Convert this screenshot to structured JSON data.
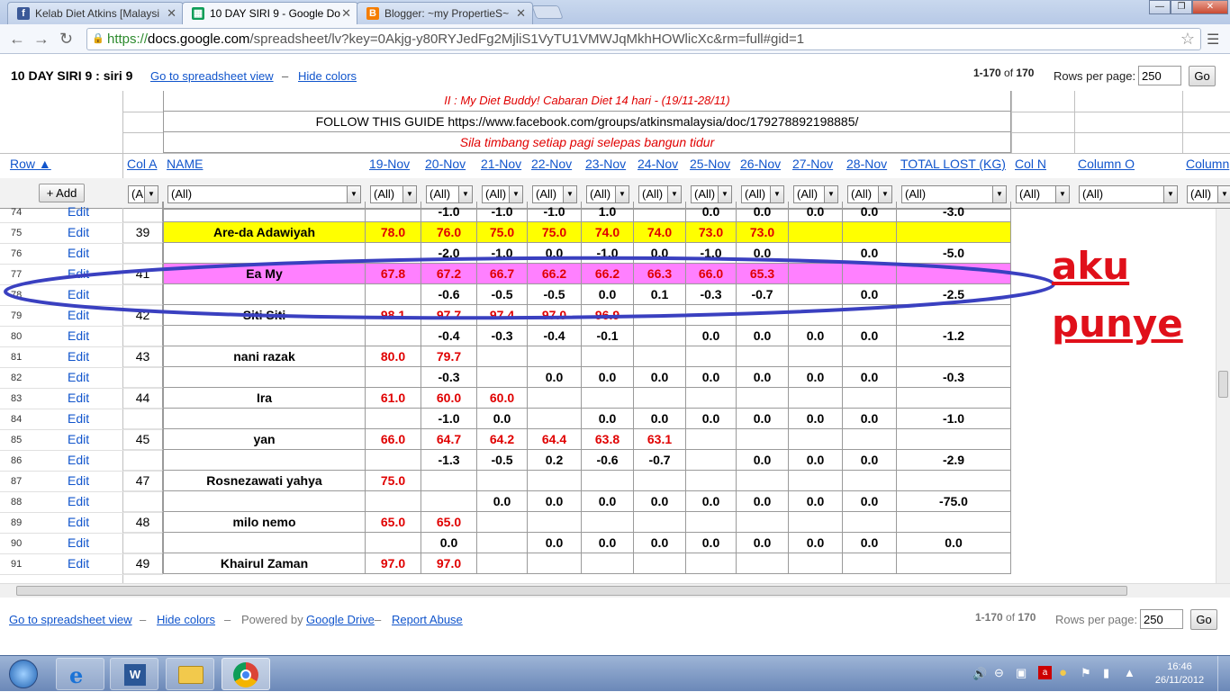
{
  "browser": {
    "tabs": [
      {
        "title": "Kelab Diet Atkins [Malaysi",
        "icon": "facebook-icon",
        "active": false
      },
      {
        "title": "10 DAY SIRI 9 - Google Do",
        "icon": "google-sheets-icon",
        "active": true
      },
      {
        "title": "Blogger: ~my PropertieS~",
        "icon": "blogger-icon",
        "active": false
      }
    ],
    "url_proto": "https://",
    "url_host": "docs.google.com",
    "url_path": "/spreadsheet/lv?key=0Akjg-y80RYJedFg2MjliS1VyTU1VMWJqMkhHOWlicXc&rm=full#gid=1"
  },
  "header": {
    "title": "10 DAY SIRI 9 : siri 9",
    "goto_link": "Go to spreadsheet view",
    "dash": "–",
    "hide_colors": "Hide colors",
    "page_range": "1-170",
    "page_of": "of",
    "page_total": "170",
    "rows_per_page_label": "Rows per page:",
    "rows_per_page_value": "250",
    "go_label": "Go"
  },
  "banner": {
    "line1": "II : My Diet Buddy! Cabaran Diet 14 hari - (19/11-28/11)",
    "line2": "FOLLOW THIS GUIDE https://www.facebook.com/groups/atkinsmalaysia/doc/179278892198885/",
    "line3": "Sila timbang setiap pagi selepas bangun tidur"
  },
  "columns": {
    "row": "Row ▲",
    "add": "+ Add",
    "headers": [
      "Col A",
      "NAME",
      "19-Nov",
      "20-Nov",
      "21-Nov",
      "22-Nov",
      "23-Nov",
      "24-Nov",
      "25-Nov",
      "26-Nov",
      "27-Nov",
      "28-Nov",
      "TOTAL LOST (KG)",
      "Col N",
      "Column O",
      "Column"
    ],
    "filters": [
      "(A",
      "(All)",
      "(All)",
      "(All)",
      "(All)",
      "(All)",
      "(All)",
      "(All)",
      "(All)",
      "(All)",
      "(All)",
      "(All)",
      "(All)",
      "(All)",
      "(All)",
      "(All)"
    ]
  },
  "rows": [
    {
      "num": "74",
      "edit": "Edit",
      "colA": "",
      "name": "",
      "vals": [
        "",
        "-1.0",
        "-1.0",
        "-1.0",
        "1.0",
        "",
        "0.0",
        "0.0",
        "0.0",
        "0.0"
      ],
      "total": "-3.0",
      "bg": ""
    },
    {
      "num": "75",
      "edit": "Edit",
      "colA": "39",
      "name": "Are-da Adawiyah",
      "vals": [
        "78.0",
        "76.0",
        "75.0",
        "75.0",
        "74.0",
        "74.0",
        "73.0",
        "73.0",
        "",
        ""
      ],
      "total": "",
      "bg": "#ffff00"
    },
    {
      "num": "76",
      "edit": "Edit",
      "colA": "",
      "name": "",
      "vals": [
        "",
        "-2.0",
        "-1.0",
        "0.0",
        "-1.0",
        "0.0",
        "-1.0",
        "0.0",
        "",
        "0.0"
      ],
      "total": "-5.0",
      "bg": ""
    },
    {
      "num": "77",
      "edit": "Edit",
      "colA": "41",
      "name": "Ea My",
      "vals": [
        "67.8",
        "67.2",
        "66.7",
        "66.2",
        "66.2",
        "66.3",
        "66.0",
        "65.3",
        "",
        ""
      ],
      "total": "",
      "bg": "#ff80ff"
    },
    {
      "num": "78",
      "edit": "Edit",
      "colA": "",
      "name": "",
      "vals": [
        "",
        "-0.6",
        "-0.5",
        "-0.5",
        "0.0",
        "0.1",
        "-0.3",
        "-0.7",
        "",
        "0.0"
      ],
      "total": "-2.5",
      "bg": ""
    },
    {
      "num": "79",
      "edit": "Edit",
      "colA": "42",
      "name": "Siti Siti",
      "vals": [
        "98.1",
        "97.7",
        "97.4",
        "97.0",
        "96.9",
        "",
        "",
        "",
        "",
        ""
      ],
      "total": "",
      "bg": ""
    },
    {
      "num": "80",
      "edit": "Edit",
      "colA": "",
      "name": "",
      "vals": [
        "",
        "-0.4",
        "-0.3",
        "-0.4",
        "-0.1",
        "",
        "0.0",
        "0.0",
        "0.0",
        "0.0"
      ],
      "total": "-1.2",
      "bg": ""
    },
    {
      "num": "81",
      "edit": "Edit",
      "colA": "43",
      "name": "nani razak",
      "vals": [
        "80.0",
        "79.7",
        "",
        "",
        "",
        "",
        "",
        "",
        "",
        ""
      ],
      "total": "",
      "bg": ""
    },
    {
      "num": "82",
      "edit": "Edit",
      "colA": "",
      "name": "",
      "vals": [
        "",
        "-0.3",
        "",
        "0.0",
        "0.0",
        "0.0",
        "0.0",
        "0.0",
        "0.0",
        "0.0"
      ],
      "total": "-0.3",
      "bg": ""
    },
    {
      "num": "83",
      "edit": "Edit",
      "colA": "44",
      "name": "Ira",
      "vals": [
        "61.0",
        "60.0",
        "60.0",
        "",
        "",
        "",
        "",
        "",
        "",
        ""
      ],
      "total": "",
      "bg": ""
    },
    {
      "num": "84",
      "edit": "Edit",
      "colA": "",
      "name": "",
      "vals": [
        "",
        "-1.0",
        "0.0",
        "",
        "0.0",
        "0.0",
        "0.0",
        "0.0",
        "0.0",
        "0.0"
      ],
      "total": "-1.0",
      "bg": ""
    },
    {
      "num": "85",
      "edit": "Edit",
      "colA": "45",
      "name": "yan",
      "vals": [
        "66.0",
        "64.7",
        "64.2",
        "64.4",
        "63.8",
        "63.1",
        "",
        "",
        "",
        ""
      ],
      "total": "",
      "bg": ""
    },
    {
      "num": "86",
      "edit": "Edit",
      "colA": "",
      "name": "",
      "vals": [
        "",
        "-1.3",
        "-0.5",
        "0.2",
        "-0.6",
        "-0.7",
        "",
        "0.0",
        "0.0",
        "0.0"
      ],
      "total": "-2.9",
      "bg": ""
    },
    {
      "num": "87",
      "edit": "Edit",
      "colA": "47",
      "name": "Rosnezawati yahya",
      "vals": [
        "75.0",
        "",
        "",
        "",
        "",
        "",
        "",
        "",
        "",
        ""
      ],
      "total": "",
      "bg": ""
    },
    {
      "num": "88",
      "edit": "Edit",
      "colA": "",
      "name": "",
      "vals": [
        "",
        "",
        "0.0",
        "0.0",
        "0.0",
        "0.0",
        "0.0",
        "0.0",
        "0.0",
        "0.0"
      ],
      "total": "-75.0",
      "bg": ""
    },
    {
      "num": "89",
      "edit": "Edit",
      "colA": "48",
      "name": "milo nemo",
      "vals": [
        "65.0",
        "65.0",
        "",
        "",
        "",
        "",
        "",
        "",
        "",
        ""
      ],
      "total": "",
      "bg": ""
    },
    {
      "num": "90",
      "edit": "Edit",
      "colA": "",
      "name": "",
      "vals": [
        "",
        "0.0",
        "",
        "0.0",
        "0.0",
        "0.0",
        "0.0",
        "0.0",
        "0.0",
        "0.0"
      ],
      "total": "0.0",
      "bg": ""
    },
    {
      "num": "91",
      "edit": "Edit",
      "colA": "49",
      "name": "Khairul Zaman",
      "vals": [
        "97.0",
        "97.0",
        "",
        "",
        "",
        "",
        "",
        "",
        "",
        ""
      ],
      "total": "",
      "bg": ""
    }
  ],
  "annotation": {
    "line1": "aku",
    "line2": "punye",
    "color": "#e0101a"
  },
  "footer": {
    "goto_link": "Go to spreadsheet view",
    "hide_colors": "Hide colors",
    "dash": "–",
    "powered": "Powered by",
    "drive": "Google Drive",
    "report": "Report Abuse",
    "page_range": "1-170",
    "page_of": "of",
    "page_total": "170",
    "rows_per_page_label": "Rows per page:",
    "rows_per_page_value": "250",
    "go_label": "Go"
  },
  "taskbar": {
    "time": "16:46",
    "date": "26/11/2012",
    "apps": [
      "start-orb-icon",
      "internet-explorer-icon",
      "word-icon",
      "file-explorer-icon",
      "chrome-icon"
    ]
  }
}
